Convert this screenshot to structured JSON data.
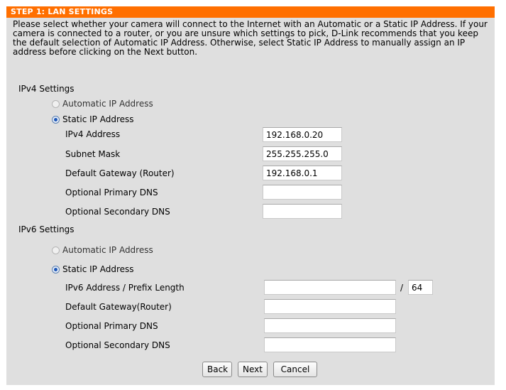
{
  "header": {
    "title": "STEP 1: LAN SETTINGS"
  },
  "description": "Please select whether your camera will connect to the Internet with an Automatic or a Static IP Address. If your camera is connected to a router, or you are unsure which settings to pick, D-Link recommends that you keep the default selection of Automatic IP Address. Otherwise, select Static IP Address to manually assign an IP address before clicking on the Next button.",
  "ipv4": {
    "section_label": "IPv4 Settings",
    "auto_label": "Automatic IP Address",
    "static_label": "Static IP Address",
    "selected": "static",
    "fields": {
      "address": {
        "label": "IPv4 Address",
        "value": "192.168.0.20"
      },
      "subnet": {
        "label": "Subnet Mask",
        "value": "255.255.255.0"
      },
      "gateway": {
        "label": "Default Gateway (Router)",
        "value": "192.168.0.1"
      },
      "primary_dns": {
        "label": "Optional Primary DNS",
        "value": ""
      },
      "secondary_dns": {
        "label": "Optional Secondary DNS",
        "value": ""
      }
    }
  },
  "ipv6": {
    "section_label": "IPv6 Settings",
    "auto_label": "Automatic IP Address",
    "static_label": "Static IP Address",
    "selected": "static",
    "fields": {
      "address": {
        "label": "IPv6 Address / Prefix Length",
        "value": "",
        "prefix_separator": "/",
        "prefix": "64"
      },
      "gateway": {
        "label": "Default Gateway(Router)",
        "value": ""
      },
      "primary_dns": {
        "label": "Optional Primary DNS",
        "value": ""
      },
      "secondary_dns": {
        "label": "Optional Secondary DNS",
        "value": ""
      }
    }
  },
  "buttons": {
    "back": "Back",
    "next": "Next",
    "cancel": "Cancel"
  },
  "colors": {
    "header_bg": "#ff6f00",
    "panel_bg": "#dfdfdf"
  }
}
